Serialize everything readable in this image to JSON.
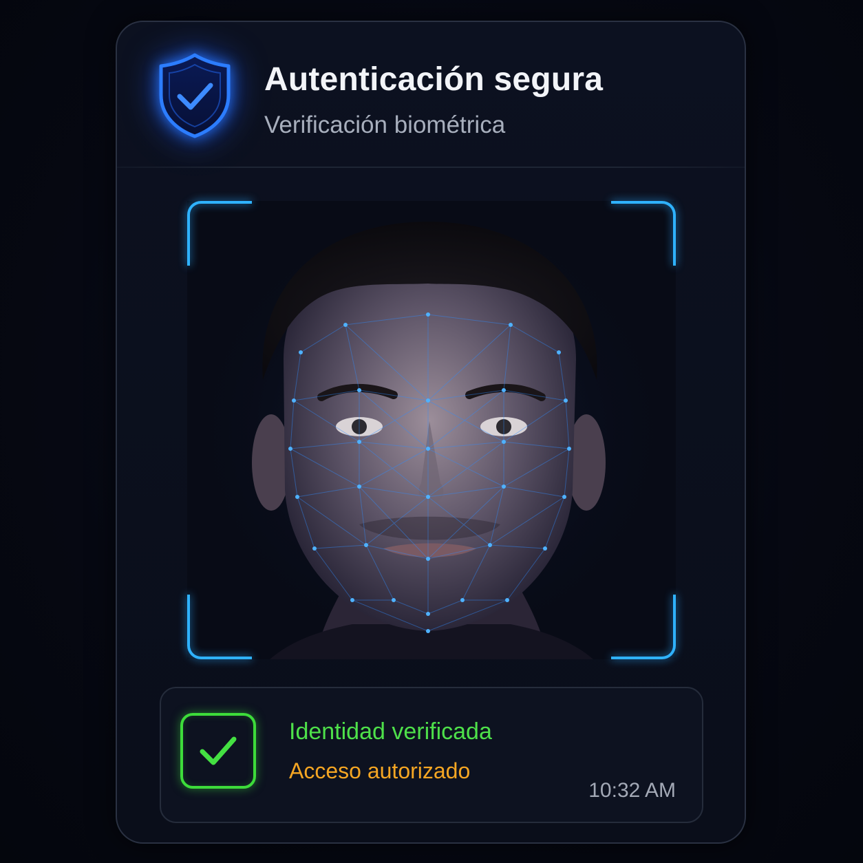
{
  "header": {
    "title": "Autenticación segura",
    "subtitle": "Verificación biométrica",
    "icon": "shield-check-icon"
  },
  "scanner": {
    "image_subject": "face-scan-photo",
    "frame_color": "#2fb2ff",
    "mesh_color": "#2f8cff"
  },
  "status": {
    "icon": "checkmark-icon",
    "title": "Identidad verificada",
    "subtitle": "Acceso autorizado",
    "time": "10:32 AM",
    "title_color": "#4ee04a",
    "subtitle_color": "#f5a623"
  },
  "colors": {
    "background": "#060812",
    "card": "#0c1120",
    "accent": "#2f7cff"
  }
}
